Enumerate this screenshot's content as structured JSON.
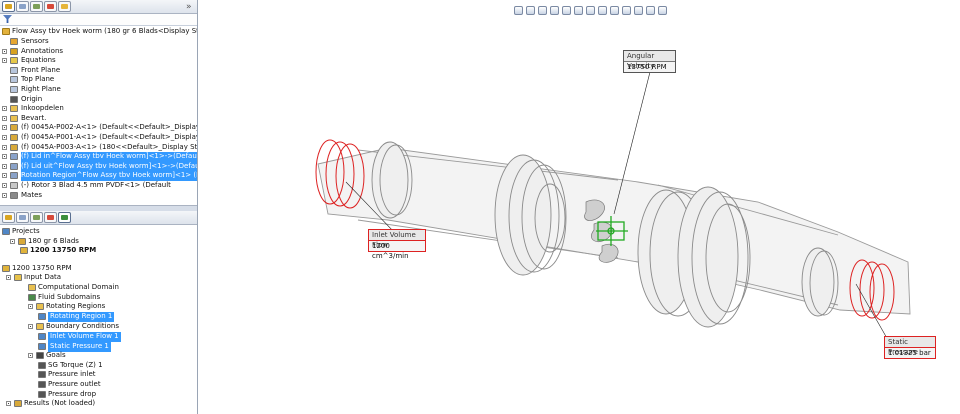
{
  "feature_tree": {
    "root": "Flow Assy tbv Hoek worm (180 gr 6 Blads<Display State-1>)",
    "items": [
      "Sensors",
      "Annotations",
      "Equations",
      "Front Plane",
      "Top Plane",
      "Right Plane",
      "Origin",
      "Inkoopdelen",
      "Bevart.",
      "(f) 0045A-P002-A<1> (Default<<Default>_Display State 1>)",
      "(f) 0045A-P001-A<1> (Default<<Default>_Display State 1>)",
      "(f) 0045A-P003-A<1> (180<<Default>_Display State 1>)",
      "(f) Lid in^Flow Assy tbv Hoek worm]<1>->(Default<<D",
      "(f) Lid uit^Flow Assy tbv Hoek worm]<1>->(Default<<",
      "Rotation Region^Flow Assy tbv Hoek worm]<1> (Default",
      "(-) Rotor 3 Blad 4.5 mm PVDF<1> (Default",
      "Mates"
    ]
  },
  "project_tree": {
    "projects_label": "Projects",
    "config": "180 gr 6 Blads",
    "project": "1200 13750 RPM",
    "project_root": "1200 13750 RPM",
    "input_data": "Input Data",
    "computational_domain": "Computational Domain",
    "fluid_subdomains": "Fluid Subdomains",
    "rotating_regions": "Rotating Regions",
    "rotating_region_1": "Rotating Region 1",
    "boundary_conditions": "Boundary Conditions",
    "inlet_volume_flow_1": "Inlet Volume Flow 1",
    "static_pressure_1": "Static Pressure 1",
    "goals": "Goals",
    "goal_items": [
      "SG Torque (Z) 1",
      "Pressure inlet",
      "Pressure outlet",
      "Pressure drop"
    ],
    "results": "Results (Not loaded)"
  },
  "callouts": {
    "angular_velocity": {
      "title": "Angular Velocity",
      "value": "13750 RPM"
    },
    "inlet_volume_flow": {
      "title": "Inlet Volume Flow",
      "value": "1200 cm^3/min"
    },
    "static_pressure": {
      "title": "Static Pressure",
      "value": "1.01325 bar"
    }
  },
  "toolbar_icons": [
    "zoom-to-fit-icon",
    "zoom-area-icon",
    "zoom-in-out-icon",
    "zoom-selection-icon",
    "rotate-icon",
    "pan-icon",
    "view-orientation-icon",
    "section-view-icon",
    "display-style-icon",
    "hide-show-icon",
    "edit-appearance-icon",
    "apply-scene-icon",
    "view-settings-icon"
  ],
  "colors": {
    "selection": "#3399ff",
    "callout_red": "#dd2222",
    "rotor_green": "#22aa22"
  }
}
